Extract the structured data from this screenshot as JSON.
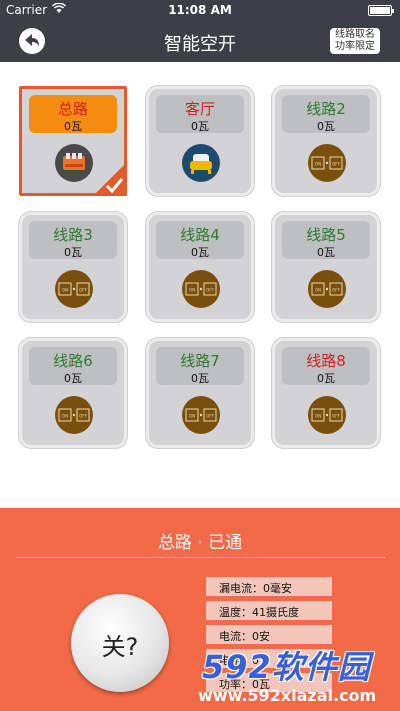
{
  "status_bar": {
    "carrier": "Carrier",
    "time": "11:08 AM"
  },
  "nav": {
    "title": "智能空开",
    "name_button_line1": "线路取名",
    "name_button_line2": "功率限定"
  },
  "circuits": [
    {
      "name": "总路",
      "power": "0瓦",
      "color": "#d41f1f"
    },
    {
      "name": "客厅",
      "power": "0瓦",
      "color": "#d41f1f"
    },
    {
      "name": "线路2",
      "power": "0瓦",
      "color": "#2e7a2e"
    },
    {
      "name": "线路3",
      "power": "0瓦",
      "color": "#2e7a2e"
    },
    {
      "name": "线路4",
      "power": "0瓦",
      "color": "#2e7a2e"
    },
    {
      "name": "线路5",
      "power": "0瓦",
      "color": "#2e7a2e"
    },
    {
      "name": "线路6",
      "power": "0瓦",
      "color": "#2e7a2e"
    },
    {
      "name": "线路7",
      "power": "0瓦",
      "color": "#2e7a2e"
    },
    {
      "name": "线路8",
      "power": "0瓦",
      "color": "#d41f1f"
    }
  ],
  "panel": {
    "heading": "总路 · 已通",
    "off_button": "关?",
    "leak_current": "漏电流：0毫安",
    "temperature": "温度：41摄氏度",
    "current": "电流：0安",
    "voltage": "电压：0",
    "power": "功率：0瓦"
  },
  "watermark": {
    "brand": "592软件园",
    "url": "www.592xiazai.com"
  }
}
